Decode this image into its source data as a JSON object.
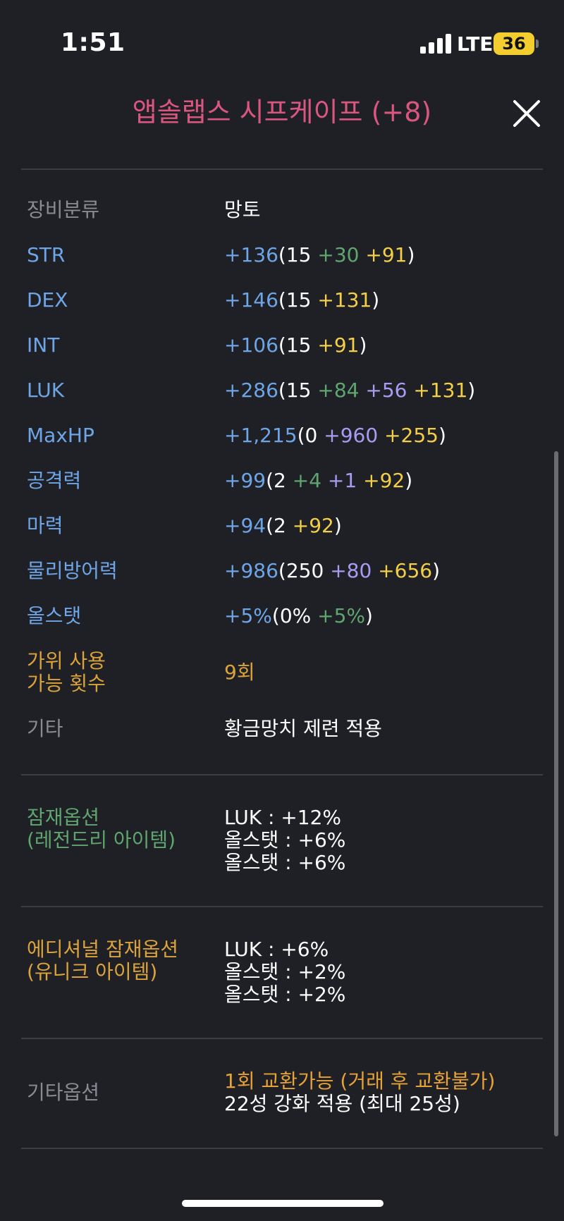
{
  "status": {
    "time": "1:51",
    "network": "LTE",
    "battery": "36"
  },
  "header": {
    "title": "앱솔랩스 시프케이프 (+8)"
  },
  "stats": [
    {
      "label": "장비분류",
      "label_color": "gray",
      "segments": [
        {
          "text": "망토",
          "color": "white"
        }
      ]
    },
    {
      "label": "STR",
      "label_color": "blue",
      "segments": [
        {
          "text": "+136",
          "color": "blue"
        },
        {
          "text": "(15 ",
          "color": "white"
        },
        {
          "text": "+30",
          "color": "green"
        },
        {
          "text": " ",
          "color": "white"
        },
        {
          "text": "+91",
          "color": "yellow"
        },
        {
          "text": ")",
          "color": "white"
        }
      ]
    },
    {
      "label": "DEX",
      "label_color": "blue",
      "segments": [
        {
          "text": "+146",
          "color": "blue"
        },
        {
          "text": "(15 ",
          "color": "white"
        },
        {
          "text": "+131",
          "color": "yellow"
        },
        {
          "text": ")",
          "color": "white"
        }
      ]
    },
    {
      "label": "INT",
      "label_color": "blue",
      "segments": [
        {
          "text": "+106",
          "color": "blue"
        },
        {
          "text": "(15 ",
          "color": "white"
        },
        {
          "text": "+91",
          "color": "yellow"
        },
        {
          "text": ")",
          "color": "white"
        }
      ]
    },
    {
      "label": "LUK",
      "label_color": "blue",
      "segments": [
        {
          "text": "+286",
          "color": "blue"
        },
        {
          "text": "(15 ",
          "color": "white"
        },
        {
          "text": "+84",
          "color": "green"
        },
        {
          "text": " ",
          "color": "white"
        },
        {
          "text": "+56",
          "color": "purple"
        },
        {
          "text": " ",
          "color": "white"
        },
        {
          "text": "+131",
          "color": "yellow"
        },
        {
          "text": ")",
          "color": "white"
        }
      ]
    },
    {
      "label": "MaxHP",
      "label_color": "blue",
      "segments": [
        {
          "text": "+1,215",
          "color": "blue"
        },
        {
          "text": "(0 ",
          "color": "white"
        },
        {
          "text": "+960",
          "color": "purple"
        },
        {
          "text": " ",
          "color": "white"
        },
        {
          "text": "+255",
          "color": "yellow"
        },
        {
          "text": ")",
          "color": "white"
        }
      ]
    },
    {
      "label": "공격력",
      "label_color": "blue",
      "segments": [
        {
          "text": "+99",
          "color": "blue"
        },
        {
          "text": "(2 ",
          "color": "white"
        },
        {
          "text": "+4",
          "color": "green"
        },
        {
          "text": " ",
          "color": "white"
        },
        {
          "text": "+1",
          "color": "purple"
        },
        {
          "text": " ",
          "color": "white"
        },
        {
          "text": "+92",
          "color": "yellow"
        },
        {
          "text": ")",
          "color": "white"
        }
      ]
    },
    {
      "label": "마력",
      "label_color": "blue",
      "segments": [
        {
          "text": "+94",
          "color": "blue"
        },
        {
          "text": "(2 ",
          "color": "white"
        },
        {
          "text": "+92",
          "color": "yellow"
        },
        {
          "text": ")",
          "color": "white"
        }
      ]
    },
    {
      "label": "물리방어력",
      "label_color": "blue",
      "segments": [
        {
          "text": "+986",
          "color": "blue"
        },
        {
          "text": "(250 ",
          "color": "white"
        },
        {
          "text": "+80",
          "color": "purple"
        },
        {
          "text": " ",
          "color": "white"
        },
        {
          "text": "+656",
          "color": "yellow"
        },
        {
          "text": ")",
          "color": "white"
        }
      ]
    },
    {
      "label": "올스탯",
      "label_color": "blue",
      "segments": [
        {
          "text": "+5%",
          "color": "blue"
        },
        {
          "text": "(0% ",
          "color": "white"
        },
        {
          "text": "+5%",
          "color": "green"
        },
        {
          "text": ")",
          "color": "white"
        }
      ]
    },
    {
      "label": "가위 사용\n가능 횟수",
      "label_color": "orange",
      "segments": [
        {
          "text": "9회",
          "color": "gold"
        }
      ]
    },
    {
      "label": "기타",
      "label_color": "gray",
      "segments": [
        {
          "text": "황금망치 제련 적용",
          "color": "white"
        }
      ]
    }
  ],
  "potential": {
    "label": "잠재옵션\n(레전드리 아이템)",
    "lines": [
      "LUK : +12%",
      "올스탯 : +6%",
      "올스탯 : +6%"
    ]
  },
  "additional_potential": {
    "label": "에디셔널 잠재옵션\n(유니크 아이템)",
    "lines": [
      "LUK : +6%",
      "올스탯 : +2%",
      "올스탯 : +2%"
    ]
  },
  "etc_options": {
    "label": "기타옵션",
    "exchange_text": "1회 교환가능 (거래 후 교환불가)",
    "star_text": "22성 강화 적용 (최대 25성)"
  },
  "colors": {
    "title": "#d9567e",
    "blue": "#6ea5e6",
    "green": "#5fa56e",
    "yellow": "#f2cf45",
    "purple": "#a79cf1",
    "orange": "#e7a235",
    "background": "#1f2026"
  }
}
